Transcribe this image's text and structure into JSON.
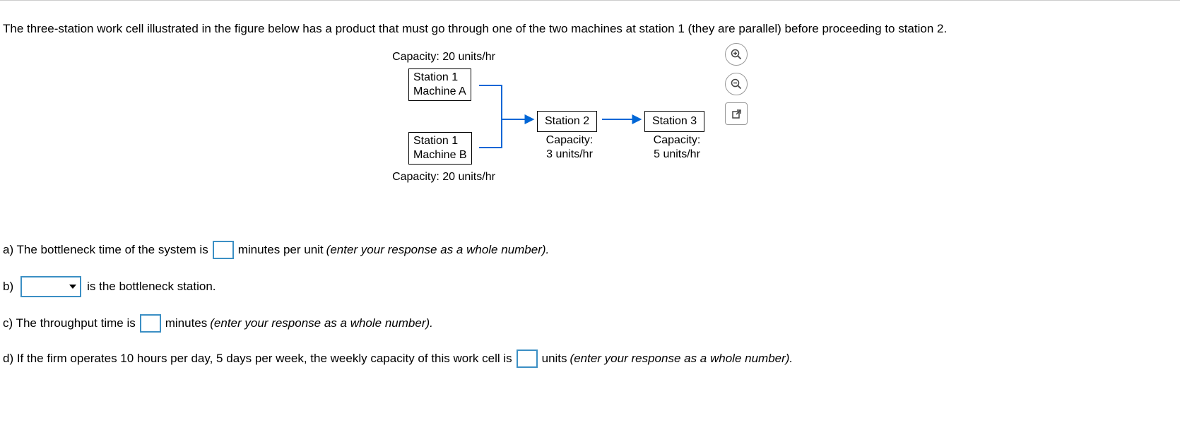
{
  "intro": "The three-station work cell illustrated in the figure below has a product that must go through one of the two machines at station 1 (they are parallel) before proceeding to station 2.",
  "diagram": {
    "capA_label": "Capacity: 20 units/hr",
    "boxA_l1": "Station 1",
    "boxA_l2": "Machine A",
    "boxB_l1": "Station 1",
    "boxB_l2": "Machine B",
    "capB_label": "Capacity: 20 units/hr",
    "box2": "Station 2",
    "cap2_l1": "Capacity:",
    "cap2_l2": "3 units/hr",
    "box3": "Station 3",
    "cap3_l1": "Capacity:",
    "cap3_l2": "5 units/hr"
  },
  "qA": {
    "pre": "a) The bottleneck time of the system is",
    "post": "minutes per unit",
    "hint": "(enter your response as a whole number)."
  },
  "qB": {
    "pre": "b)",
    "post": "is the bottleneck station."
  },
  "qC": {
    "pre": "c) The throughput time is",
    "post": "minutes",
    "hint": "(enter your response as a whole number)."
  },
  "qD": {
    "pre": "d) If the firm operates 10 hours per day, 5 days per week, the weekly capacity of this work cell is",
    "post": "units",
    "hint": "(enter your response as a whole number)."
  },
  "chart_data": {
    "type": "diagram",
    "stations": [
      {
        "name": "Station 1 Machine A",
        "capacity_units_per_hr": 20
      },
      {
        "name": "Station 1 Machine B",
        "capacity_units_per_hr": 20
      },
      {
        "name": "Station 2",
        "capacity_units_per_hr": 3
      },
      {
        "name": "Station 3",
        "capacity_units_per_hr": 5
      }
    ],
    "flow": "Station1(A or B, parallel) -> Station2 -> Station3"
  }
}
